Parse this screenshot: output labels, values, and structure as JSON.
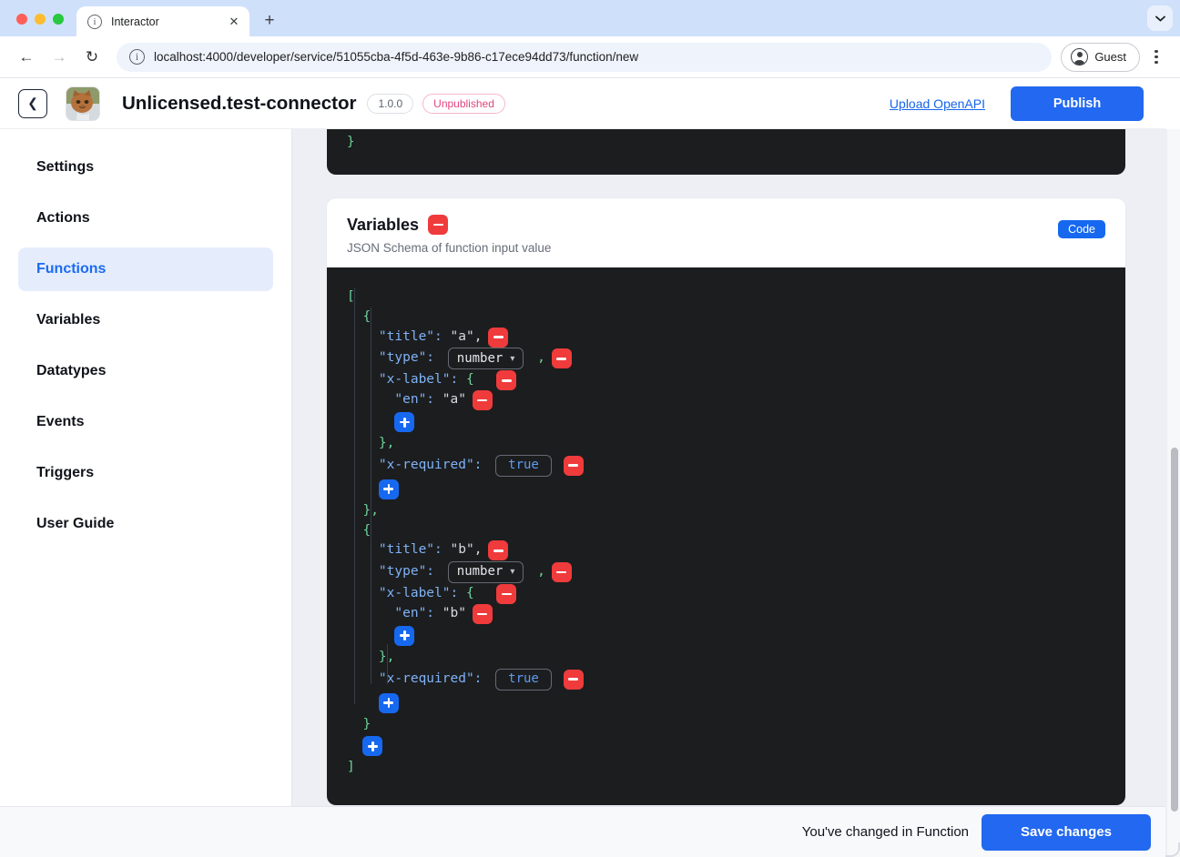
{
  "browser": {
    "tab": {
      "title": "Interactor",
      "favicon_icon": "info-circle-icon",
      "close_icon": "close-icon"
    },
    "new_tab_icon": "plus-icon",
    "tabstrip_menu_icon": "chevron-down-icon",
    "back_icon": "arrow-left-icon",
    "forward_icon": "arrow-right-icon",
    "reload_icon": "reload-icon",
    "site_info_icon": "info-circle-icon",
    "url": "localhost:4000/developer/service/51055cba-4f5d-463e-9b86-c17ece94dd73/function/new",
    "profile_label": "Guest",
    "profile_icon": "account-circle-icon",
    "menu_icon": "kebab-menu-icon"
  },
  "header": {
    "back_icon": "chevron-left-icon",
    "avatar_icon": "cat-avatar",
    "title": "Unlicensed.test-connector",
    "version": "1.0.0",
    "status": "Unpublished",
    "upload_link": "Upload OpenAPI",
    "publish_label": "Publish"
  },
  "sidebar": {
    "items": [
      {
        "label": "Settings",
        "active": false
      },
      {
        "label": "Actions",
        "active": false
      },
      {
        "label": "Functions",
        "active": true
      },
      {
        "label": "Variables",
        "active": false
      },
      {
        "label": "Datatypes",
        "active": false
      },
      {
        "label": "Events",
        "active": false
      },
      {
        "label": "Triggers",
        "active": false
      },
      {
        "label": "User Guide",
        "active": false
      }
    ]
  },
  "prev_card": {
    "closing_brace": "}"
  },
  "card": {
    "title": "Variables",
    "remove_icon": "minus-icon",
    "subtitle": "JSON Schema of function input value",
    "code_toggle_label": "Code"
  },
  "editor": {
    "lines": [
      {
        "id": "l1",
        "indent": 0,
        "text": "[",
        "kind": "bracket"
      },
      {
        "id": "l2",
        "indent": 1,
        "text": "{",
        "kind": "bracket"
      },
      {
        "id": "l3",
        "indent": 2,
        "key": "\"title\":",
        "value": "\"a\",",
        "minus": true
      },
      {
        "id": "l4",
        "indent": 2,
        "key": "\"type\":",
        "select": "number",
        "trail": ",",
        "minus": true
      },
      {
        "id": "l5",
        "indent": 2,
        "key": "\"x-label\":",
        "brace": "{",
        "minus": true
      },
      {
        "id": "l6",
        "indent": 3,
        "key": "\"en\":",
        "value": "\"a\"",
        "minus": true
      },
      {
        "id": "l7",
        "indent": 3,
        "plus": true
      },
      {
        "id": "l8",
        "indent": 2,
        "text": "},",
        "kind": "bracket"
      },
      {
        "id": "l9",
        "indent": 2,
        "key": "\"x-required\":",
        "boolean": "true",
        "minus": true
      },
      {
        "id": "l10",
        "indent": 2,
        "plus": true
      },
      {
        "id": "l11",
        "indent": 1,
        "text": "},",
        "kind": "bracket"
      },
      {
        "id": "l12",
        "indent": 1,
        "text": "{",
        "kind": "bracket"
      },
      {
        "id": "l13",
        "indent": 2,
        "key": "\"title\":",
        "value": "\"b\",",
        "minus": true
      },
      {
        "id": "l14",
        "indent": 2,
        "key": "\"type\":",
        "select": "number",
        "trail": ",",
        "minus": true
      },
      {
        "id": "l15",
        "indent": 2,
        "key": "\"x-label\":",
        "brace": "{",
        "minus": true
      },
      {
        "id": "l16",
        "indent": 3,
        "key": "\"en\":",
        "value": "\"b\"",
        "minus": true
      },
      {
        "id": "l17",
        "indent": 3,
        "plus": true
      },
      {
        "id": "l18",
        "indent": 2,
        "text": "},",
        "kind": "bracket"
      },
      {
        "id": "l19",
        "indent": 2,
        "key": "\"x-required\":",
        "boolean": "true",
        "minus": true
      },
      {
        "id": "l20",
        "indent": 2,
        "plus": true
      },
      {
        "id": "l21",
        "indent": 1,
        "text": "}",
        "kind": "bracket"
      },
      {
        "id": "l22",
        "indent": 1,
        "plus": true
      },
      {
        "id": "l23",
        "indent": 0,
        "text": "]",
        "kind": "bracket"
      }
    ],
    "select_chevron_icon": "chevron-down-icon",
    "add_icon": "plus-icon",
    "remove_icon": "minus-icon"
  },
  "savebar": {
    "message": "You've changed in Function",
    "save_label": "Save changes"
  },
  "colors": {
    "accent_blue": "#2268f0",
    "danger_red": "#ef3b3b",
    "editor_bg": "#1c1d1f",
    "status_pink": "#e0457f",
    "content_bg": "#edeff4",
    "active_nav_bg": "#e5edfd"
  }
}
